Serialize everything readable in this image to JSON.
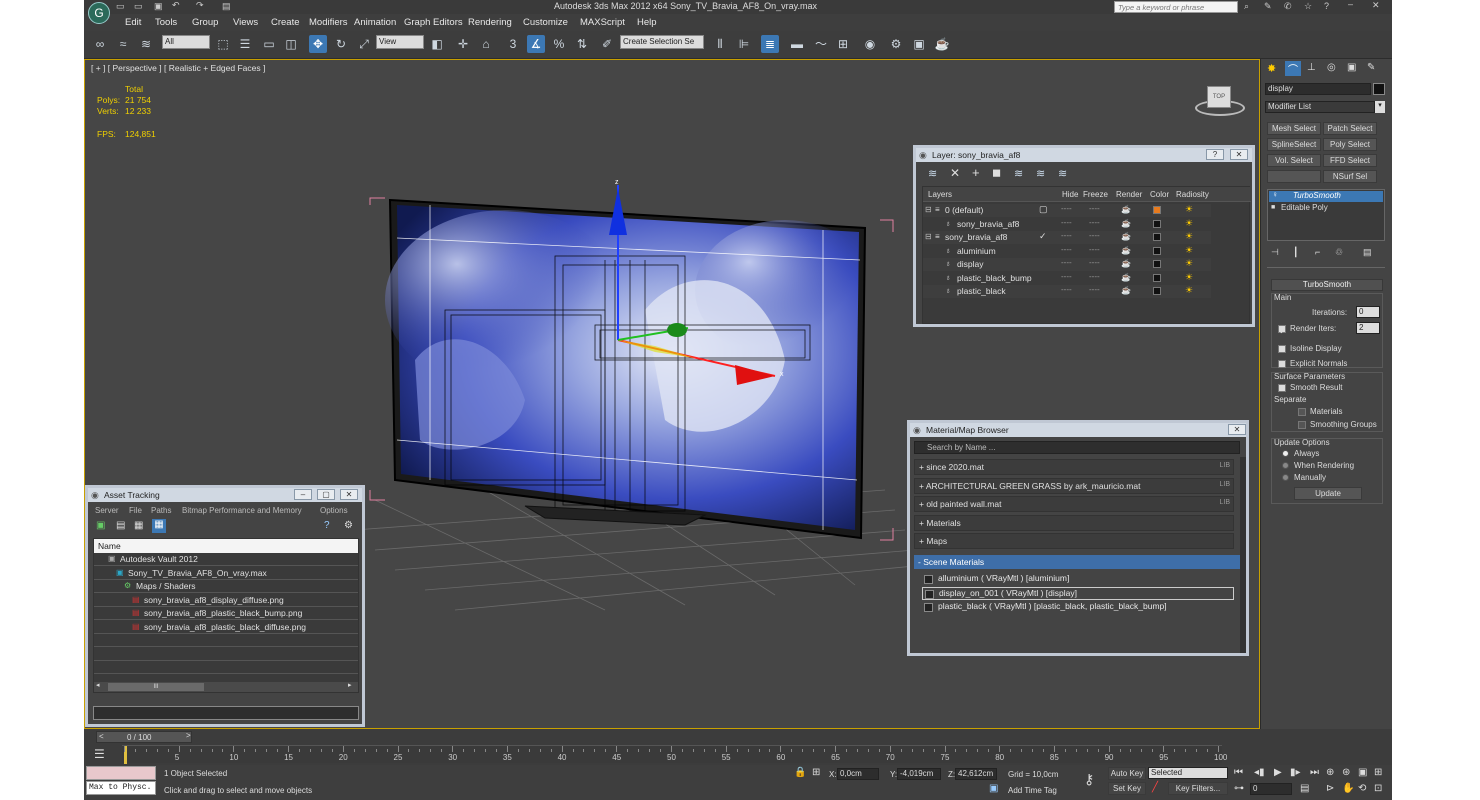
{
  "app": {
    "title": "Autodesk 3ds Max  2012 x64     Sony_TV_Bravia_AF8_On_vray.max",
    "search_placeholder": "Type a keyword or phrase"
  },
  "menu": [
    "Edit",
    "Tools",
    "Group",
    "Views",
    "Create",
    "Modifiers",
    "Animation",
    "Graph Editors",
    "Rendering",
    "Customize",
    "MAXScript",
    "Help"
  ],
  "toolbar": {
    "selection_filter": "All",
    "reference_coord": "View",
    "named_selection": "Create Selection Se",
    "snap_label": "3"
  },
  "viewport": {
    "label": "[ + ] [ Perspective ] [ Realistic + Edged Faces ]",
    "stats": {
      "total_label": "Total",
      "polys_label": "Polys:",
      "polys_value": "21 754",
      "verts_label": "Verts:",
      "verts_value": "12 233",
      "fps_label": "FPS:",
      "fps_value": "124,851"
    },
    "viewcube_label": "TOP"
  },
  "command_panel": {
    "object_name": "display",
    "modifier_list": "Modifier List",
    "buttons": [
      "Mesh Select",
      "Patch Select",
      "SplineSelect",
      "Poly Select",
      "Vol. Select",
      "FFD Select",
      "",
      "NSurf Sel"
    ],
    "stack": [
      "TurboSmooth",
      "Editable Poly"
    ],
    "rollout_title": "TurboSmooth",
    "main_label": "Main",
    "iterations_label": "Iterations:",
    "iterations_value": "0",
    "render_iters_label": "Render Iters:",
    "render_iters_value": "2",
    "isoline_label": "Isoline Display",
    "explicit_normals_label": "Explicit Normals",
    "surface_params_label": "Surface Parameters",
    "smooth_result_label": "Smooth Result",
    "separate_label": "Separate",
    "materials_label": "Materials",
    "smoothing_groups_label": "Smoothing Groups",
    "update_options_label": "Update Options",
    "always_label": "Always",
    "when_rendering_label": "When Rendering",
    "manually_label": "Manually",
    "update_button": "Update"
  },
  "layer_dialog": {
    "title": "Layer: sony_bravia_af8",
    "help_btn": "?",
    "close_btn": "✕",
    "columns": [
      "Layers",
      "Hide",
      "Freeze",
      "Render",
      "Color",
      "Radiosity"
    ],
    "rows": [
      {
        "name": "0 (default)",
        "indent": 0,
        "color": "#e87b1e",
        "check": "▢"
      },
      {
        "name": "sony_bravia_af8",
        "indent": 1,
        "color": "#111111",
        "check": ""
      },
      {
        "name": "sony_bravia_af8",
        "indent": 0,
        "color": "#111111",
        "check": "✓"
      },
      {
        "name": "aluminium",
        "indent": 1,
        "color": "#111111",
        "check": ""
      },
      {
        "name": "display",
        "indent": 1,
        "color": "#111111",
        "check": ""
      },
      {
        "name": "plastic_black_bump",
        "indent": 1,
        "color": "#111111",
        "check": ""
      },
      {
        "name": "plastic_black",
        "indent": 1,
        "color": "#111111",
        "check": ""
      }
    ],
    "dash": "----"
  },
  "material_browser": {
    "title": "Material/Map Browser",
    "close_btn": "✕",
    "search_placeholder": "Search by Name ...",
    "libraries": [
      {
        "label": "+ since 2020.mat",
        "tag": "LIB"
      },
      {
        "label": "+ ARCHITECTURAL GREEN GRASS by ark_mauricio.mat",
        "tag": "LIB"
      },
      {
        "label": "+ old painted wall.mat",
        "tag": "LIB"
      },
      {
        "label": "+ Materials",
        "tag": ""
      },
      {
        "label": "+ Maps",
        "tag": ""
      }
    ],
    "scene_materials_label": "- Scene Materials",
    "scene_materials": [
      "alluminium  ( VRayMtl ) [aluminium]",
      "display_on_001  ( VRayMtl ) [display]",
      "plastic_black ( VRayMtl ) [plastic_black, plastic_black_bump]"
    ]
  },
  "asset_tracking": {
    "title": "Asset Tracking",
    "menu": [
      "Server",
      "File",
      "Paths",
      "Bitmap Performance and Memory",
      "Options"
    ],
    "column": "Name",
    "rows": [
      {
        "label": "Autodesk Vault 2012",
        "indent": 1
      },
      {
        "label": "Sony_TV_Bravia_AF8_On_vray.max",
        "indent": 2
      },
      {
        "label": "Maps / Shaders",
        "indent": 3
      },
      {
        "label": "sony_bravia_af8_display_diffuse.png",
        "indent": 4
      },
      {
        "label": "sony_bravia_af8_plastic_black_bump.png",
        "indent": 4
      },
      {
        "label": "sony_bravia_af8_plastic_black_diffuse.png",
        "indent": 4
      }
    ],
    "scroll_thumb": "III"
  },
  "timeline": {
    "frame_label": "0 / 100",
    "ticks": [
      "5",
      "10",
      "15",
      "20",
      "25",
      "30",
      "35",
      "40",
      "45",
      "50",
      "55",
      "60",
      "65",
      "70",
      "75",
      "80",
      "85",
      "90",
      "95",
      "100"
    ]
  },
  "status": {
    "script_listener": "Max to Physc.",
    "selected_text": "1 Object Selected",
    "prompt_text": "Click and drag to select and move objects",
    "x_label": "X:",
    "x_value": "0,0cm",
    "y_label": "Y:",
    "y_value": "-4,019cm",
    "z_label": "Z:",
    "z_value": "42,612cm",
    "grid_text": "Grid = 10,0cm",
    "add_time_tag": "Add Time Tag",
    "auto_key": "Auto Key",
    "set_key": "Set Key",
    "key_mode": "Selected",
    "key_filters": "Key Filters...",
    "frame_value": "0"
  }
}
